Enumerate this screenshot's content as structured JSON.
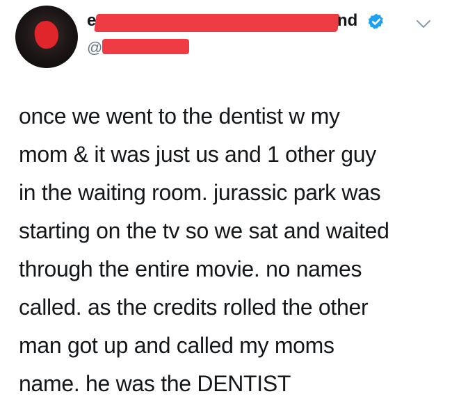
{
  "author": {
    "name_visible_start": "e",
    "name_visible_end": "nd",
    "handle_visible": "@",
    "verified": true
  },
  "icons": {
    "verified_badge": "verified-badge-icon",
    "more_menu": "chevron-down-icon"
  },
  "colors": {
    "redaction": "#ef3b43",
    "verified_blue": "#1da1f2",
    "text": "#14171a",
    "secondary_text": "#657786"
  },
  "tweet": {
    "lines": [
      "once we went to the dentist w my",
      "mom & it was just us and 1 other guy",
      "in the waiting room. jurassic park was",
      "starting on the tv so we sat and waited",
      "through the entire movie. no names",
      "called. as the credits rolled the other",
      "man got up and called my moms",
      "name. he was the DENTIST"
    ]
  }
}
